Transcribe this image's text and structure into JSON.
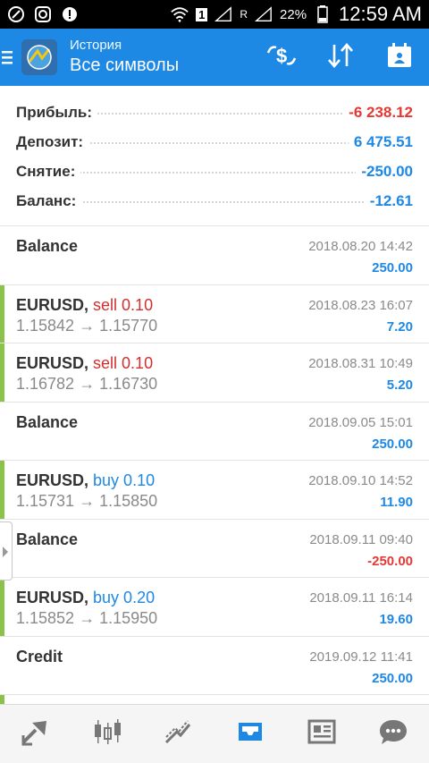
{
  "status_bar": {
    "battery_pct": "22%",
    "time": "12:59 AM",
    "signal_label": "1",
    "roaming_label": "R"
  },
  "app_bar": {
    "subtitle": "История",
    "title": "Все символы"
  },
  "summary": [
    {
      "label": "Прибыль:",
      "value": "-6 238.12",
      "color": "#e53935"
    },
    {
      "label": "Депозит:",
      "value": "6 475.51",
      "color": "#1e88e5"
    },
    {
      "label": "Снятие:",
      "value": "-250.00",
      "color": "#1e88e5"
    },
    {
      "label": "Баланс:",
      "value": "-12.61",
      "color": "#1e88e5"
    }
  ],
  "history": [
    {
      "symbol": "Balance",
      "direction": "",
      "dir_type": "",
      "prices": "",
      "time": "2018.08.20 14:42",
      "profit": "250.00",
      "profit_color": "#1e88e5",
      "accent": false
    },
    {
      "symbol": "EURUSD,",
      "direction": "sell 0.10",
      "dir_type": "sell",
      "prices": "1.15842 → 1.15770",
      "time": "2018.08.23 16:07",
      "profit": "7.20",
      "profit_color": "#1e88e5",
      "accent": true
    },
    {
      "symbol": "EURUSD,",
      "direction": "sell 0.10",
      "dir_type": "sell",
      "prices": "1.16782 → 1.16730",
      "time": "2018.08.31 10:49",
      "profit": "5.20",
      "profit_color": "#1e88e5",
      "accent": true
    },
    {
      "symbol": "Balance",
      "direction": "",
      "dir_type": "",
      "prices": "",
      "time": "2018.09.05 15:01",
      "profit": "250.00",
      "profit_color": "#1e88e5",
      "accent": false
    },
    {
      "symbol": "EURUSD,",
      "direction": "buy 0.10",
      "dir_type": "buy",
      "prices": "1.15731 → 1.15850",
      "time": "2018.09.10 14:52",
      "profit": "11.90",
      "profit_color": "#1e88e5",
      "accent": true
    },
    {
      "symbol": "Balance",
      "direction": "",
      "dir_type": "",
      "prices": "",
      "time": "2018.09.11 09:40",
      "profit": "-250.00",
      "profit_color": "#e53935",
      "accent": false
    },
    {
      "symbol": "EURUSD,",
      "direction": "buy 0.20",
      "dir_type": "buy",
      "prices": "1.15852 → 1.15950",
      "time": "2018.09.11 16:14",
      "profit": "19.60",
      "profit_color": "#1e88e5",
      "accent": true
    },
    {
      "symbol": "Credit",
      "direction": "",
      "dir_type": "",
      "prices": "",
      "time": "2019.09.12 11:41",
      "profit": "250.00",
      "profit_color": "#1e88e5",
      "accent": false
    }
  ],
  "bottom_nav": [
    {
      "icon": "quotes-icon",
      "active": false
    },
    {
      "icon": "chart-candles-icon",
      "active": false
    },
    {
      "icon": "trade-icon",
      "active": false
    },
    {
      "icon": "history-inbox-icon",
      "active": true
    },
    {
      "icon": "news-icon",
      "active": false
    },
    {
      "icon": "chat-icon",
      "active": false
    }
  ],
  "colors": {
    "accent": "#1e88e5",
    "negative": "#e53935",
    "positive_bar": "#8bc34a"
  }
}
